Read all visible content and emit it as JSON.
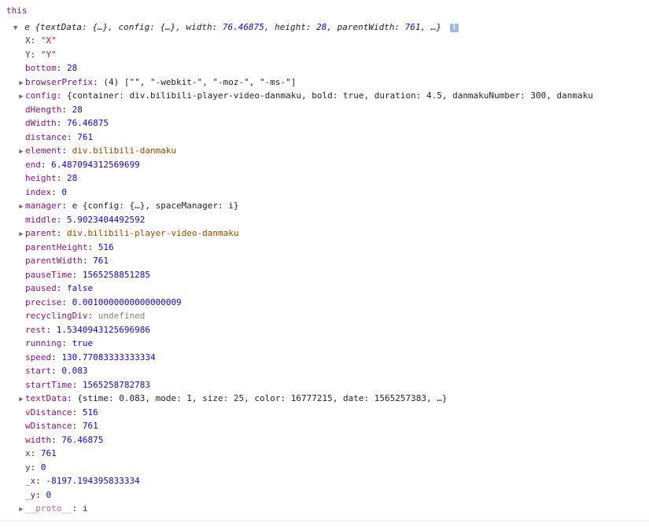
{
  "console": {
    "log_label": "this",
    "object_summary": {
      "prefix": "e",
      "text": "{textData: {…}, config: {…}, width: ",
      "width": "76.46875",
      "sep1": ", height: ",
      "height": "28",
      "sep2": ", parentWidth: ",
      "parentWidth": "761",
      "suffix": ", …}",
      "info_icon": "info-icon",
      "info_glyph": "i"
    },
    "props": [
      {
        "key": "X",
        "type": "str",
        "value": "\"X\"",
        "expandable": false
      },
      {
        "key": "Y",
        "type": "str",
        "value": "\"Y\"",
        "expandable": false
      },
      {
        "key": "bottom",
        "type": "num",
        "value": "28",
        "expandable": false
      },
      {
        "key": "browserPrefix",
        "type": "obj",
        "value": "(4) [\"\", \"-webkit-\", \"-moz-\", \"-ms-\"]",
        "expandable": true
      },
      {
        "key": "config",
        "type": "obj",
        "value": "{container: div.bilibili-player-video-danmaku, bold: true, duration: 4.5, danmakuNumber: 300, danmaku",
        "expandable": true
      },
      {
        "key": "dHength",
        "type": "num",
        "value": "28",
        "expandable": false
      },
      {
        "key": "dWidth",
        "type": "num",
        "value": "76.46875",
        "expandable": false
      },
      {
        "key": "distance",
        "type": "num",
        "value": "761",
        "expandable": false
      },
      {
        "key": "element",
        "type": "node",
        "value": "div.bilibili-danmaku",
        "expandable": true
      },
      {
        "key": "end",
        "type": "num",
        "value": "6.487094312569699",
        "expandable": false
      },
      {
        "key": "height",
        "type": "num",
        "value": "28",
        "expandable": false
      },
      {
        "key": "index",
        "type": "num",
        "value": "0",
        "expandable": false
      },
      {
        "key": "manager",
        "type": "obj",
        "value": "e {config: {…}, spaceManager: i}",
        "expandable": true
      },
      {
        "key": "middle",
        "type": "num",
        "value": "5.9023404492592",
        "expandable": false
      },
      {
        "key": "parent",
        "type": "node",
        "value": "div.bilibili-player-video-danmaku",
        "expandable": true
      },
      {
        "key": "parentHeight",
        "type": "num",
        "value": "516",
        "expandable": false
      },
      {
        "key": "parentWidth",
        "type": "num",
        "value": "761",
        "expandable": false
      },
      {
        "key": "pauseTime",
        "type": "num",
        "value": "1565258851285",
        "expandable": false
      },
      {
        "key": "paused",
        "type": "bool",
        "value": "false",
        "expandable": false
      },
      {
        "key": "precise",
        "type": "num",
        "value": "0.0010000000000000009",
        "expandable": false
      },
      {
        "key": "recyclingDiv",
        "type": "undef",
        "value": "undefined",
        "expandable": false
      },
      {
        "key": "rest",
        "type": "num",
        "value": "1.5340943125696986",
        "expandable": false
      },
      {
        "key": "running",
        "type": "bool",
        "value": "true",
        "expandable": false
      },
      {
        "key": "speed",
        "type": "num",
        "value": "130.77083333333334",
        "expandable": false
      },
      {
        "key": "start",
        "type": "num",
        "value": "0.083",
        "expandable": false
      },
      {
        "key": "startTime",
        "type": "num",
        "value": "1565258782783",
        "expandable": false
      },
      {
        "key": "textData",
        "type": "obj",
        "value": "{stime: 0.083, mode: 1, size: 25, color: 16777215, date: 1565257383, …}",
        "expandable": true
      },
      {
        "key": "vDistance",
        "type": "num",
        "value": "516",
        "expandable": false
      },
      {
        "key": "wDistance",
        "type": "num",
        "value": "761",
        "expandable": false
      },
      {
        "key": "width",
        "type": "num",
        "value": "76.46875",
        "expandable": false
      },
      {
        "key": "x",
        "type": "num",
        "value": "761",
        "expandable": false
      },
      {
        "key": "y",
        "type": "num",
        "value": "0",
        "expandable": false
      },
      {
        "key": "_x",
        "type": "num",
        "value": "-8197.194395833334",
        "expandable": false
      },
      {
        "key": "_y",
        "type": "num",
        "value": "0",
        "expandable": false
      },
      {
        "key": "__proto__",
        "type": "obj",
        "value": "i",
        "expandable": true,
        "dim": true
      }
    ],
    "icons": {
      "collapsed_arrow": "triangle-right-icon",
      "expanded_arrow": "triangle-down-icon"
    },
    "glyphs": {
      "collapsed": "▶",
      "expanded": "▼"
    }
  }
}
